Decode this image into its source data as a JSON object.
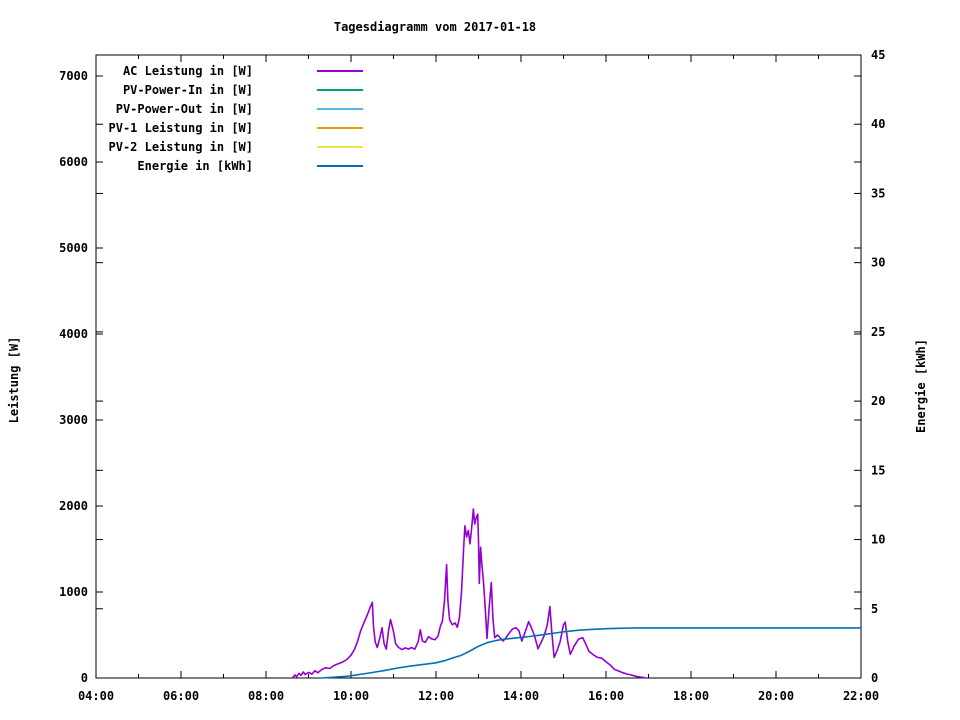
{
  "chart_data": {
    "type": "line",
    "title": "Tagesdiagramm vom 2017-01-18",
    "grid": false,
    "legend_position": "top-left-inside",
    "x_axis": {
      "label": "",
      "range": [
        4,
        22
      ],
      "major_ticks": [
        4,
        6,
        8,
        10,
        12,
        14,
        16,
        18,
        20,
        22
      ],
      "tick_labels": [
        "04:00",
        "06:00",
        "08:00",
        "10:00",
        "12:00",
        "14:00",
        "16:00",
        "18:00",
        "20:00",
        "22:00"
      ],
      "minor_ticks": [
        5,
        7,
        9,
        11,
        13,
        15,
        17,
        19,
        21
      ]
    },
    "y_axis": {
      "label": "Leistung [W]",
      "range": [
        0,
        7244
      ],
      "major_ticks": [
        0,
        1000,
        2000,
        3000,
        4000,
        5000,
        6000,
        7000
      ],
      "tick_labels": [
        "0",
        "1000",
        "2000",
        "3000",
        "4000",
        "5000",
        "6000",
        "7000"
      ]
    },
    "y2_axis": {
      "label": "Energie [kWh]",
      "range": [
        0,
        45
      ],
      "major_ticks": [
        0,
        5,
        10,
        15,
        20,
        25,
        30,
        35,
        40,
        45
      ],
      "tick_labels": [
        "0",
        "5",
        "10",
        "15",
        "20",
        "25",
        "30",
        "35",
        "40",
        "45"
      ]
    },
    "series": [
      {
        "id": "ac-leistung-line",
        "name": "AC Leistung in [W]",
        "color": "#9400d3",
        "axis": "y",
        "visible": true,
        "points": [
          [
            8.62,
            0
          ],
          [
            8.68,
            35
          ],
          [
            8.72,
            15
          ],
          [
            8.78,
            55
          ],
          [
            8.82,
            30
          ],
          [
            8.88,
            70
          ],
          [
            8.92,
            40
          ],
          [
            9.0,
            65
          ],
          [
            9.08,
            45
          ],
          [
            9.15,
            85
          ],
          [
            9.22,
            60
          ],
          [
            9.3,
            95
          ],
          [
            9.4,
            120
          ],
          [
            9.5,
            110
          ],
          [
            9.6,
            145
          ],
          [
            9.7,
            165
          ],
          [
            9.8,
            185
          ],
          [
            9.9,
            215
          ],
          [
            10.0,
            265
          ],
          [
            10.08,
            330
          ],
          [
            10.15,
            420
          ],
          [
            10.22,
            540
          ],
          [
            10.3,
            640
          ],
          [
            10.38,
            730
          ],
          [
            10.45,
            820
          ],
          [
            10.5,
            880
          ],
          [
            10.53,
            600
          ],
          [
            10.57,
            420
          ],
          [
            10.62,
            355
          ],
          [
            10.68,
            470
          ],
          [
            10.73,
            585
          ],
          [
            10.78,
            400
          ],
          [
            10.83,
            335
          ],
          [
            10.88,
            540
          ],
          [
            10.93,
            680
          ],
          [
            11.0,
            540
          ],
          [
            11.05,
            400
          ],
          [
            11.12,
            355
          ],
          [
            11.2,
            330
          ],
          [
            11.28,
            350
          ],
          [
            11.35,
            335
          ],
          [
            11.42,
            355
          ],
          [
            11.5,
            335
          ],
          [
            11.58,
            420
          ],
          [
            11.63,
            560
          ],
          [
            11.68,
            430
          ],
          [
            11.75,
            415
          ],
          [
            11.82,
            480
          ],
          [
            11.9,
            455
          ],
          [
            11.98,
            445
          ],
          [
            12.05,
            490
          ],
          [
            12.1,
            600
          ],
          [
            12.15,
            660
          ],
          [
            12.2,
            900
          ],
          [
            12.25,
            1320
          ],
          [
            12.28,
            900
          ],
          [
            12.32,
            680
          ],
          [
            12.38,
            620
          ],
          [
            12.45,
            640
          ],
          [
            12.5,
            590
          ],
          [
            12.55,
            700
          ],
          [
            12.6,
            1000
          ],
          [
            12.65,
            1500
          ],
          [
            12.68,
            1770
          ],
          [
            12.72,
            1640
          ],
          [
            12.76,
            1715
          ],
          [
            12.8,
            1560
          ],
          [
            12.84,
            1750
          ],
          [
            12.88,
            1965
          ],
          [
            12.91,
            1790
          ],
          [
            12.95,
            1870
          ],
          [
            12.98,
            1905
          ],
          [
            13.0,
            1600
          ],
          [
            13.02,
            1100
          ],
          [
            13.05,
            1520
          ],
          [
            13.08,
            1320
          ],
          [
            13.12,
            1100
          ],
          [
            13.16,
            800
          ],
          [
            13.2,
            460
          ],
          [
            13.25,
            810
          ],
          [
            13.3,
            1110
          ],
          [
            13.34,
            700
          ],
          [
            13.38,
            470
          ],
          [
            13.45,
            500
          ],
          [
            13.52,
            460
          ],
          [
            13.58,
            430
          ],
          [
            13.65,
            470
          ],
          [
            13.72,
            520
          ],
          [
            13.8,
            570
          ],
          [
            13.88,
            585
          ],
          [
            13.95,
            550
          ],
          [
            14.02,
            430
          ],
          [
            14.1,
            540
          ],
          [
            14.18,
            655
          ],
          [
            14.25,
            580
          ],
          [
            14.32,
            490
          ],
          [
            14.4,
            340
          ],
          [
            14.48,
            420
          ],
          [
            14.55,
            500
          ],
          [
            14.62,
            620
          ],
          [
            14.68,
            830
          ],
          [
            14.72,
            560
          ],
          [
            14.78,
            240
          ],
          [
            14.85,
            320
          ],
          [
            14.92,
            420
          ],
          [
            15.0,
            620
          ],
          [
            15.04,
            650
          ],
          [
            15.1,
            420
          ],
          [
            15.16,
            275
          ],
          [
            15.25,
            370
          ],
          [
            15.35,
            450
          ],
          [
            15.45,
            470
          ],
          [
            15.52,
            400
          ],
          [
            15.6,
            310
          ],
          [
            15.7,
            270
          ],
          [
            15.8,
            240
          ],
          [
            15.9,
            230
          ],
          [
            16.0,
            190
          ],
          [
            16.1,
            150
          ],
          [
            16.2,
            100
          ],
          [
            16.3,
            80
          ],
          [
            16.4,
            60
          ],
          [
            16.5,
            45
          ],
          [
            16.6,
            35
          ],
          [
            16.7,
            20
          ],
          [
            16.8,
            12
          ],
          [
            16.9,
            5
          ],
          [
            16.95,
            0
          ]
        ]
      },
      {
        "id": "pv-power-in-line",
        "name": "PV-Power-In in [W]",
        "color": "#009e73",
        "axis": "y",
        "visible": false,
        "points": []
      },
      {
        "id": "pv-power-out-line",
        "name": "PV-Power-Out in [W]",
        "color": "#56b4e9",
        "axis": "y",
        "visible": false,
        "points": []
      },
      {
        "id": "pv1-leistung-line",
        "name": "PV-1 Leistung in [W]",
        "color": "#e69f00",
        "axis": "y",
        "visible": false,
        "points": []
      },
      {
        "id": "pv2-leistung-line",
        "name": "PV-2 Leistung in [W]",
        "color": "#f0e442",
        "axis": "y",
        "visible": false,
        "points": []
      },
      {
        "id": "energie-line",
        "name": "Energie in [kWh]",
        "color": "#0072b2",
        "axis": "y2",
        "visible": true,
        "points": [
          [
            9.3,
            0
          ],
          [
            9.6,
            0.06
          ],
          [
            9.9,
            0.12
          ],
          [
            10.2,
            0.25
          ],
          [
            10.5,
            0.4
          ],
          [
            10.8,
            0.55
          ],
          [
            11.1,
            0.72
          ],
          [
            11.4,
            0.86
          ],
          [
            11.7,
            0.98
          ],
          [
            12.0,
            1.1
          ],
          [
            12.2,
            1.25
          ],
          [
            12.4,
            1.45
          ],
          [
            12.6,
            1.65
          ],
          [
            12.8,
            1.95
          ],
          [
            13.0,
            2.3
          ],
          [
            13.2,
            2.55
          ],
          [
            13.4,
            2.7
          ],
          [
            13.6,
            2.8
          ],
          [
            13.8,
            2.87
          ],
          [
            14.0,
            2.93
          ],
          [
            14.2,
            3.0
          ],
          [
            14.5,
            3.12
          ],
          [
            14.8,
            3.25
          ],
          [
            15.1,
            3.37
          ],
          [
            15.4,
            3.46
          ],
          [
            15.7,
            3.52
          ],
          [
            16.0,
            3.56
          ],
          [
            16.3,
            3.59
          ],
          [
            16.6,
            3.61
          ],
          [
            17.0,
            3.62
          ],
          [
            19.0,
            3.62
          ],
          [
            22.0,
            3.62
          ]
        ]
      }
    ],
    "colors": {
      "axis": "#000000",
      "background": "#ffffff",
      "text": "#000000"
    }
  }
}
